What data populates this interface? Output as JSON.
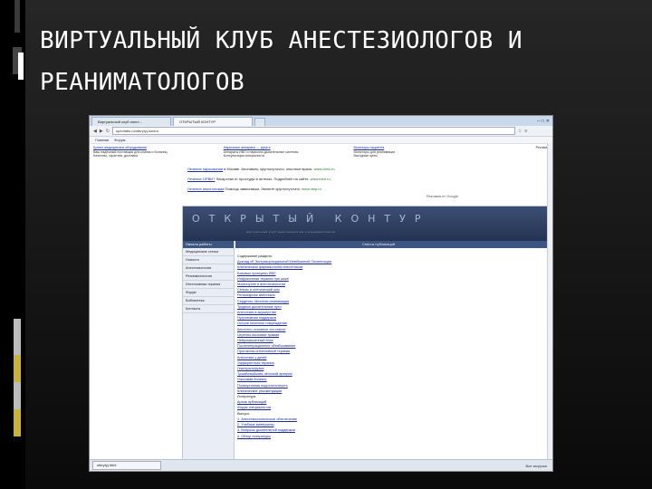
{
  "slide": {
    "title": "ВИРТУАЛЬНЫЙ КЛУБ АНЕСТЕЗИОЛОГОВ И РЕАНИМАТОЛОГОВ"
  },
  "browser": {
    "tabs": [
      {
        "label": "Виртуальный клуб анест..."
      },
      {
        "label": "ОТКРЫТЫЙ КОНТУР"
      },
      {
        "label": ""
      }
    ],
    "address": "openlabs.ru/otkrytyj-kontur",
    "bookmarks": [
      "Главная",
      "Форум"
    ],
    "nav_icons": [
      "back-icon",
      "forward-icon",
      "reload-icon",
      "home-icon"
    ],
    "window_controls": [
      "minimize-icon",
      "maximize-icon",
      "close-icon"
    ]
  },
  "ads_top": {
    "left": {
      "title": "Купить медицинское оборудование",
      "line1": "Ваш надёжный поставщик для клиник и больниц",
      "line2": "Качество, гарантия, доставка",
      "sub": "Поставки по России"
    },
    "middle": {
      "title": "Наркозные аппараты — купить",
      "line1": "Аппараты ИВЛ и наркозно-дыхательные системы",
      "line2": "Консультация специалиста"
    },
    "right_block": {
      "title": "Мониторы пациента",
      "line1": "Мониторы для реанимации",
      "line2": "Выгодные цены"
    },
    "corner": "Реклама"
  },
  "ad_lines": [
    {
      "title": "Лечение наркомании",
      "text": "в Москве. Анонимно, круглосуточно, опытные врачи.",
      "url": "www.clinic.ru"
    },
    {
      "title": "Лечение ОРВИ?",
      "text": "Лекарства от простуды в аптеках. Подробнее на сайте.",
      "url": "www.med.ru"
    },
    {
      "title": "Лечение алкоголизма",
      "text": "Помощь зависимым. Звоните круглосуточно.",
      "url": "www.help.ru"
    }
  ],
  "google_label": "Реклама от Google",
  "site": {
    "banner_title": "ОТКРЫТЫЙ КОНТУР",
    "banner_sub": "виртуальный клуб анестезиологов и реаниматологов",
    "sidebar_head": "Начало работы",
    "sidebar_items": [
      "Медицинские статьи",
      "Новости",
      "Анестезиология",
      "Реаниматология",
      "Интенсивная терапия",
      "Форум",
      "Библиотека",
      "Контакты"
    ],
    "main_head": "Список публикаций",
    "links": [
      {
        "text": "Содержание раздела:",
        "plain": true
      },
      {
        "text": "Доклад об Экстракорпоральной Мембранной Оксигенации"
      },
      {
        "text": "Клиническая фармакология анестетиков"
      },
      {
        "text": "Базовые принципы ИВЛ"
      },
      {
        "text": "Инфузионная терапия при шоке"
      },
      {
        "text": "Мониторинг в анестезиологии"
      },
      {
        "text": "Сепсис и септический шок"
      },
      {
        "text": "Регионарная анестезия"
      },
      {
        "text": "Сердечно-лёгочная реанимация"
      },
      {
        "text": "Трудные дыхательные пути"
      },
      {
        "text": "Анестезия в акушерстве"
      },
      {
        "text": "Нутритивная поддержка"
      },
      {
        "text": "Острое почечное повреждение"
      },
      {
        "text": "Кислотно-основное состояние"
      },
      {
        "text": "Черепно-мозговая травма"
      },
      {
        "text": "Нейромышечный блок"
      },
      {
        "text": "Послеоперационное обезболивание"
      },
      {
        "text": "Протоколы интенсивной терапии"
      },
      {
        "text": "Анестезия у детей"
      },
      {
        "text": "Эфферентная терапия"
      },
      {
        "text": "Гемотрансфузия"
      },
      {
        "text": "Тромбоэмболия лёгочной артерии"
      },
      {
        "text": "Ожоговая болезнь"
      },
      {
        "text": "Полиорганная недостаточность"
      },
      {
        "text": "Клинические рекомендации"
      },
      {
        "text": "Литература",
        "plain": true
      },
      {
        "text": "Архив публикаций"
      },
      {
        "text": "Форум специалистов"
      },
      {
        "text": "Выпуск:",
        "plain": true
      },
      {
        "text": "1. Анестезиологическое обеспечение"
      },
      {
        "text": "2. Учебные материалы"
      },
      {
        "text": "3. Вопросы дыхательной поддержки"
      },
      {
        "text": "4. Обзор литературы"
      }
    ]
  },
  "statusbar": {
    "download": "otkrytyj.html",
    "right": "Все загрузки"
  }
}
